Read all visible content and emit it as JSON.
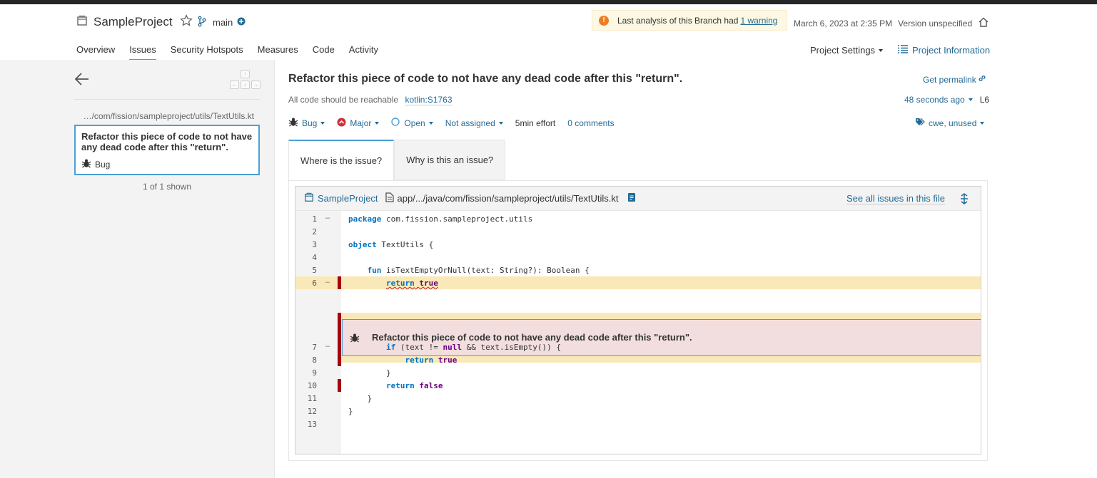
{
  "header": {
    "project_name": "SampleProject",
    "branch_name": "main",
    "warning_text": "Last analysis of this Branch had",
    "warning_link": "1 warning",
    "analysis_date": "March 6, 2023 at 2:35 PM",
    "version": "Version unspecified"
  },
  "nav": {
    "tabs": [
      "Overview",
      "Issues",
      "Security Hotspots",
      "Measures",
      "Code",
      "Activity"
    ],
    "active_tab": "Issues",
    "project_settings": "Project Settings",
    "project_information": "Project Information"
  },
  "sidebar": {
    "file_path": "…/com/fission/sampleproject/utils/TextUtils.kt",
    "issue_title": "Refactor this piece of code to not have any dead code after this \"return\".",
    "issue_type": "Bug",
    "shown_count": "1 of 1 shown"
  },
  "issue": {
    "title": "Refactor this piece of code to not have any dead code after this \"return\".",
    "permalink": "Get permalink",
    "rule_description": "All code should be reachable",
    "rule_key": "kotlin:S1763",
    "age": "48 seconds ago",
    "line": "L6",
    "type": "Bug",
    "severity": "Major",
    "status": "Open",
    "assignee": "Not assigned",
    "effort": "5min effort",
    "comments": "0 comments",
    "tags": "cwe, unused"
  },
  "tabs": {
    "where": "Where is the issue?",
    "why": "Why is this an issue?"
  },
  "viewer": {
    "project": "SampleProject",
    "file": "app/.../java/com/fission/sampleproject/utils/TextUtils.kt",
    "see_all": "See all issues in this file",
    "message": "Refactor this piece of code to not have any dead code after this \"return\".",
    "lines": [
      {
        "n": "1",
        "code": "package com.fission.sampleproject.utils"
      },
      {
        "n": "2",
        "code": ""
      },
      {
        "n": "3",
        "code": "object TextUtils {"
      },
      {
        "n": "4",
        "code": ""
      },
      {
        "n": "5",
        "code": "    fun isTextEmptyOrNull(text: String?): Boolean {"
      },
      {
        "n": "6",
        "code": "        return true"
      },
      {
        "n": "7",
        "code": "        if (text != null && text.isEmpty()) {"
      },
      {
        "n": "8",
        "code": "            return true"
      },
      {
        "n": "9",
        "code": "        }"
      },
      {
        "n": "10",
        "code": "        return false"
      },
      {
        "n": "11",
        "code": "    }"
      },
      {
        "n": "12",
        "code": "}"
      },
      {
        "n": "13",
        "code": ""
      }
    ]
  },
  "colors": {
    "link": "#236a97",
    "accent": "#4b9fd5",
    "issue_marker": "#a4030f",
    "highlight": "#f9e9b8",
    "message_bg": "#f2dede"
  }
}
